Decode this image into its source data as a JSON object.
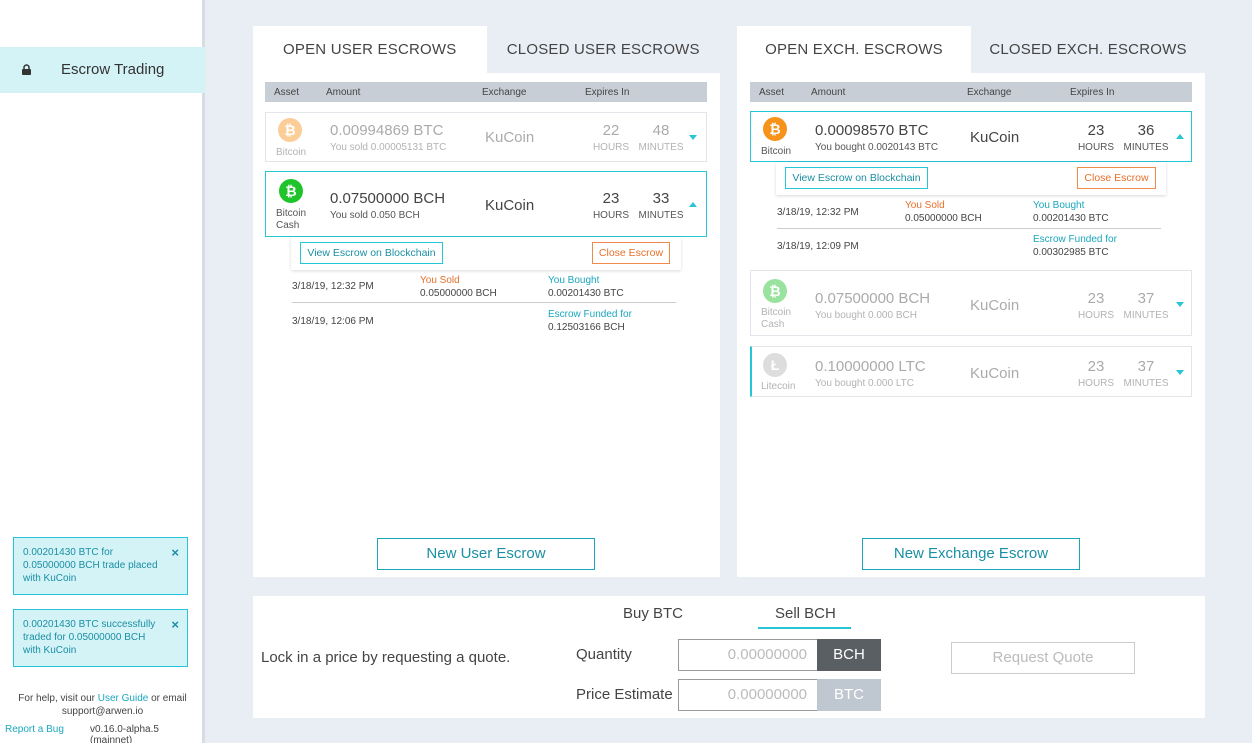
{
  "sidebar": {
    "nav_item": "Escrow Trading",
    "toasts": [
      {
        "text": "0.00201430 BTC for 0.05000000 BCH trade placed with KuCoin"
      },
      {
        "text": "0.00201430 BTC successfully traded for 0.05000000 BCH with KuCoin"
      }
    ],
    "help_prefix": "For help, visit our",
    "help_link": "User Guide",
    "help_suffix": "or email",
    "help_email": "support@arwen.io",
    "report_bug": "Report a Bug",
    "version": "v0.16.0-alpha.5 (mainnet)"
  },
  "user_panel": {
    "tabs": [
      "OPEN USER ESCROWS",
      "CLOSED USER ESCROWS"
    ],
    "headers": {
      "asset": "Asset",
      "amount": "Amount",
      "exchange": "Exchange",
      "expires": "Expires In"
    },
    "rows": [
      {
        "coin": "Bitcoin",
        "amount": "0.00994869 BTC",
        "sub": "You sold 0.00005131 BTC",
        "exchange": "KuCoin",
        "hours": "22",
        "minutes": "48",
        "hours_label": "HOURS",
        "minutes_label": "MINUTES"
      },
      {
        "coin_line1": "Bitcoin",
        "coin_line2": "Cash",
        "amount": "0.07500000 BCH",
        "sub": "You sold 0.050 BCH",
        "exchange": "KuCoin",
        "hours": "23",
        "minutes": "33",
        "hours_label": "HOURS",
        "minutes_label": "MINUTES"
      }
    ],
    "detail": {
      "view_btn": "View Escrow on Blockchain",
      "close_btn": "Close Escrow",
      "history": [
        {
          "date": "3/18/19, 12:32 PM",
          "sold_label": "You Sold",
          "sold_value": "0.05000000 BCH",
          "bought_label": "You Bought",
          "bought_value": "0.00201430 BTC"
        },
        {
          "date": "3/18/19, 12:06 PM",
          "funded_label": "Escrow Funded for",
          "funded_value": "0.12503166 BCH"
        }
      ]
    },
    "new_btn": "New User Escrow"
  },
  "exch_panel": {
    "tabs": [
      "OPEN EXCH. ESCROWS",
      "CLOSED EXCH. ESCROWS"
    ],
    "headers": {
      "asset": "Asset",
      "amount": "Amount",
      "exchange": "Exchange",
      "expires": "Expires In"
    },
    "rows": [
      {
        "coin": "Bitcoin",
        "amount": "0.00098570 BTC",
        "sub": "You bought 0.0020143 BTC",
        "exchange": "KuCoin",
        "hours": "23",
        "minutes": "36",
        "hours_label": "HOURS",
        "minutes_label": "MINUTES"
      },
      {
        "coin_line1": "Bitcoin",
        "coin_line2": "Cash",
        "amount": "0.07500000 BCH",
        "sub": "You bought 0.000 BCH",
        "exchange": "KuCoin",
        "hours": "23",
        "minutes": "37",
        "hours_label": "HOURS",
        "minutes_label": "MINUTES"
      },
      {
        "coin": "Litecoin",
        "amount": "0.10000000 LTC",
        "sub": "You bought 0.000 LTC",
        "exchange": "KuCoin",
        "hours": "23",
        "minutes": "37",
        "hours_label": "HOURS",
        "minutes_label": "MINUTES"
      }
    ],
    "detail": {
      "view_btn": "View Escrow on Blockchain",
      "close_btn": "Close Escrow",
      "history": [
        {
          "date": "3/18/19, 12:32 PM",
          "sold_label": "You Sold",
          "sold_value": "0.05000000 BCH",
          "bought_label": "You Bought",
          "bought_value": "0.00201430 BTC"
        },
        {
          "date": "3/18/19, 12:09 PM",
          "funded_label": "Escrow Funded for",
          "funded_value": "0.00302985 BTC"
        }
      ]
    },
    "new_btn": "New Exchange Escrow"
  },
  "quote": {
    "tabs": [
      "Buy BTC",
      "Sell BCH"
    ],
    "active_tab": "Sell BCH",
    "prompt": "Lock in a price by requesting a quote.",
    "quantity_label": "Quantity",
    "quantity_placeholder": "0.00000000",
    "quantity_unit": "BCH",
    "price_label": "Price Estimate",
    "price_placeholder": "0.00000000",
    "price_unit": "BTC",
    "request_btn": "Request Quote"
  },
  "colors": {
    "accent": "#26c6d6",
    "bitcoin": "#f7931a",
    "bitcoin_cash": "#1fc32a",
    "litecoin": "#b5b5b5",
    "close_orange": "#e8702a"
  }
}
